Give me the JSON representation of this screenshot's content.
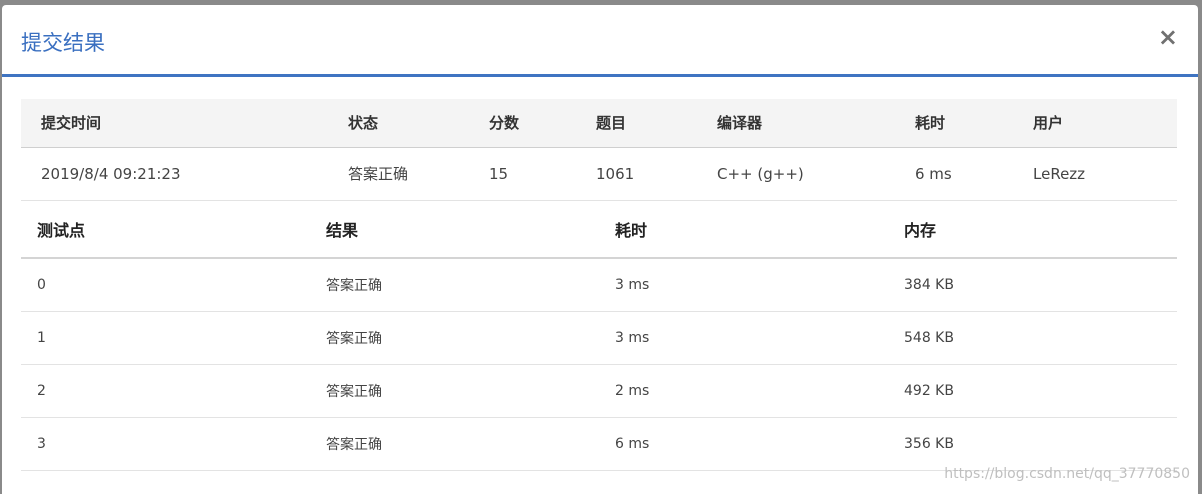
{
  "modal": {
    "title": "提交结果",
    "close_label": "×"
  },
  "summary": {
    "headers": [
      "提交时间",
      "状态",
      "分数",
      "题目",
      "编译器",
      "耗时",
      "用户"
    ],
    "row": {
      "time": "2019/8/4 09:21:23",
      "status": "答案正确",
      "score": "15",
      "problem": "1061",
      "compiler": "C++ (g++)",
      "elapsed": "6 ms",
      "user": "LeRezz"
    }
  },
  "cases": {
    "headers": [
      "测试点",
      "结果",
      "耗时",
      "内存"
    ],
    "rows": [
      {
        "id": "0",
        "result": "答案正确",
        "time": "3 ms",
        "memory": "384 KB"
      },
      {
        "id": "1",
        "result": "答案正确",
        "time": "3 ms",
        "memory": "548 KB"
      },
      {
        "id": "2",
        "result": "答案正确",
        "time": "2 ms",
        "memory": "492 KB"
      },
      {
        "id": "3",
        "result": "答案正确",
        "time": "6 ms",
        "memory": "356 KB"
      }
    ]
  },
  "watermark": "https://blog.csdn.net/qq_37770850",
  "colors": {
    "accent": "#3f74c2",
    "success_text": "#e0403a",
    "link": "#2d66b0"
  }
}
